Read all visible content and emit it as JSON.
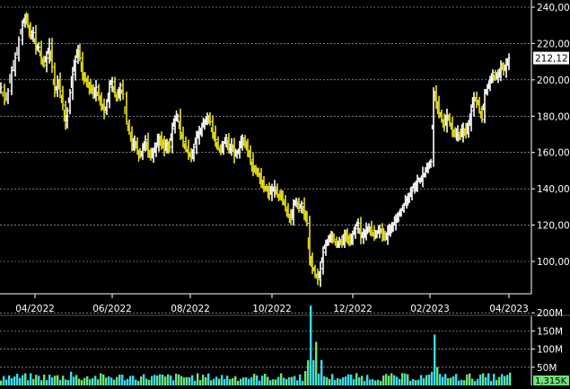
{
  "chart_data": [
    {
      "type": "ohlc",
      "ylim": [
        84,
        243
      ],
      "y_ticks": [
        "240,00",
        "220,00",
        "200,00",
        "180,00",
        "160,00",
        "140,00",
        "120,00",
        "100,00"
      ],
      "y_tick_values": [
        240,
        220,
        200,
        180,
        160,
        140,
        120,
        100
      ],
      "x_ticks": [
        "04/2022",
        "06/2022",
        "08/2022",
        "10/2022",
        "12/2022",
        "02/2023",
        "04/2023"
      ],
      "last_price_label": "212,12",
      "grid": true,
      "colors": {
        "background": "#000000",
        "up": "#ffffff",
        "down": "#e8e020",
        "grid": "#c8c8c8",
        "axis": "#ffffff"
      },
      "close_path": [
        [
          0,
          196
        ],
        [
          4,
          188
        ],
        [
          8,
          194
        ],
        [
          12,
          205
        ],
        [
          16,
          212
        ],
        [
          20,
          222
        ],
        [
          24,
          230
        ],
        [
          27,
          235
        ],
        [
          30,
          230
        ],
        [
          33,
          224
        ],
        [
          36,
          226
        ],
        [
          39,
          218
        ],
        [
          42,
          218
        ],
        [
          45,
          212
        ],
        [
          48,
          208
        ],
        [
          51,
          212
        ],
        [
          54,
          220
        ],
        [
          57,
          207
        ],
        [
          60,
          193
        ],
        [
          63,
          200
        ],
        [
          66,
          194
        ],
        [
          69,
          186
        ],
        [
          72,
          175
        ],
        [
          74,
          183
        ],
        [
          77,
          193
        ],
        [
          80,
          203
        ],
        [
          83,
          210
        ],
        [
          86,
          218
        ],
        [
          88,
          212
        ],
        [
          91,
          203
        ],
        [
          94,
          200
        ],
        [
          97,
          198
        ],
        [
          100,
          195
        ],
        [
          103,
          192
        ],
        [
          106,
          196
        ],
        [
          109,
          190
        ],
        [
          112,
          186
        ],
        [
          115,
          182
        ],
        [
          118,
          188
        ],
        [
          121,
          196
        ],
        [
          124,
          199
        ],
        [
          127,
          193
        ],
        [
          130,
          190
        ],
        [
          133,
          197
        ],
        [
          136,
          192
        ],
        [
          140,
          177
        ],
        [
          143,
          171
        ],
        [
          146,
          164
        ],
        [
          149,
          166
        ],
        [
          152,
          161
        ],
        [
          155,
          158
        ],
        [
          158,
          163
        ],
        [
          161,
          167
        ],
        [
          164,
          161
        ],
        [
          167,
          157
        ],
        [
          170,
          160
        ],
        [
          173,
          163
        ],
        [
          176,
          168
        ],
        [
          179,
          165
        ],
        [
          182,
          162
        ],
        [
          185,
          165
        ],
        [
          188,
          163
        ],
        [
          191,
          173
        ],
        [
          194,
          178
        ],
        [
          197,
          180
        ],
        [
          200,
          171
        ],
        [
          203,
          166
        ],
        [
          206,
          163
        ],
        [
          209,
          160
        ],
        [
          212,
          157
        ],
        [
          215,
          163
        ],
        [
          218,
          168
        ],
        [
          221,
          171
        ],
        [
          224,
          174
        ],
        [
          227,
          177
        ],
        [
          230,
          180
        ],
        [
          233,
          177
        ],
        [
          236,
          171
        ],
        [
          239,
          167
        ],
        [
          242,
          163
        ],
        [
          245,
          160
        ],
        [
          248,
          165
        ],
        [
          251,
          168
        ],
        [
          254,
          162
        ],
        [
          257,
          164
        ],
        [
          260,
          158
        ],
        [
          263,
          160
        ],
        [
          266,
          163
        ],
        [
          269,
          168
        ],
        [
          272,
          164
        ],
        [
          275,
          161
        ],
        [
          278,
          156
        ],
        [
          281,
          151
        ],
        [
          284,
          150
        ],
        [
          287,
          148
        ],
        [
          290,
          144
        ],
        [
          293,
          141
        ],
        [
          296,
          140
        ],
        [
          299,
          137
        ],
        [
          302,
          139
        ],
        [
          305,
          141
        ],
        [
          308,
          137
        ],
        [
          311,
          136
        ],
        [
          314,
          134
        ],
        [
          317,
          130
        ],
        [
          320,
          126
        ],
        [
          323,
          123
        ],
        [
          326,
          131
        ],
        [
          329,
          134
        ],
        [
          332,
          128
        ],
        [
          335,
          132
        ],
        [
          338,
          126
        ],
        [
          341,
          121
        ],
        [
          344,
          102
        ],
        [
          347,
          96
        ],
        [
          350,
          93
        ],
        [
          353,
          90
        ],
        [
          356,
          96
        ],
        [
          359,
          105
        ],
        [
          362,
          110
        ],
        [
          365,
          113
        ],
        [
          368,
          114
        ],
        [
          371,
          112
        ],
        [
          374,
          109
        ],
        [
          377,
          112
        ],
        [
          380,
          110
        ],
        [
          383,
          115
        ],
        [
          386,
          113
        ],
        [
          389,
          111
        ],
        [
          392,
          115
        ],
        [
          395,
          118
        ],
        [
          398,
          121
        ],
        [
          401,
          113
        ],
        [
          404,
          115
        ],
        [
          407,
          118
        ],
        [
          410,
          119
        ],
        [
          413,
          117
        ],
        [
          416,
          114
        ],
        [
          419,
          116
        ],
        [
          422,
          117
        ],
        [
          425,
          115
        ],
        [
          428,
          113
        ],
        [
          431,
          116
        ],
        [
          434,
          118
        ],
        [
          437,
          120
        ],
        [
          440,
          123
        ],
        [
          443,
          126
        ],
        [
          446,
          128
        ],
        [
          449,
          131
        ],
        [
          452,
          134
        ],
        [
          455,
          136
        ],
        [
          458,
          139
        ],
        [
          461,
          142
        ],
        [
          464,
          144
        ],
        [
          467,
          145
        ],
        [
          470,
          148
        ],
        [
          473,
          150
        ],
        [
          476,
          153
        ],
        [
          479,
          155
        ],
        [
          482,
          193
        ],
        [
          485,
          188
        ],
        [
          488,
          182
        ],
        [
          491,
          178
        ],
        [
          494,
          175
        ],
        [
          497,
          180
        ],
        [
          500,
          176
        ],
        [
          503,
          172
        ],
        [
          506,
          170
        ],
        [
          509,
          171
        ],
        [
          512,
          169
        ],
        [
          515,
          173
        ],
        [
          518,
          171
        ],
        [
          521,
          175
        ],
        [
          524,
          183
        ],
        [
          527,
          190
        ],
        [
          530,
          188
        ],
        [
          533,
          184
        ],
        [
          536,
          178
        ],
        [
          539,
          193
        ],
        [
          542,
          196
        ],
        [
          545,
          200
        ],
        [
          548,
          204
        ],
        [
          551,
          201
        ],
        [
          554,
          203
        ],
        [
          557,
          207
        ],
        [
          560,
          205
        ],
        [
          563,
          208
        ],
        [
          566,
          212
        ]
      ],
      "volume": {
        "ylim": [
          0,
          240
        ],
        "y_ticks": [
          "200M",
          "150M",
          "100M",
          "50M"
        ],
        "y_tick_values": [
          200,
          150,
          100,
          50
        ],
        "last_volume_label": "1,315K",
        "colors": {
          "up": "#3dd8e8",
          "down": "#6ee07a"
        },
        "spikes": [
          [
            77,
            38
          ],
          [
            345,
            220
          ],
          [
            350,
            120
          ],
          [
            358,
            70
          ],
          [
            484,
            140
          ],
          [
            567,
            35
          ]
        ]
      }
    }
  ]
}
